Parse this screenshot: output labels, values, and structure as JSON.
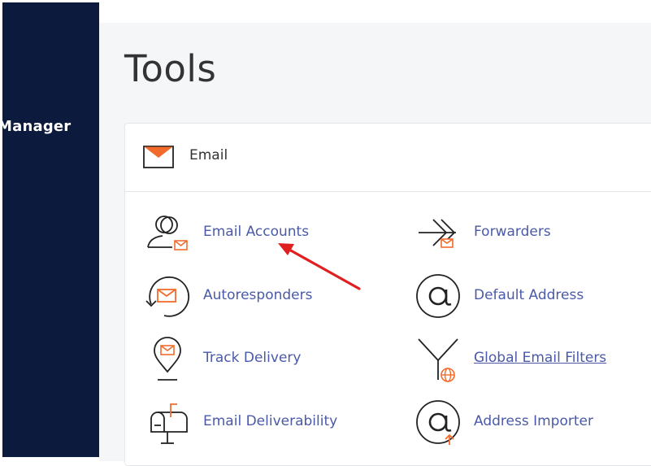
{
  "sidebar": {
    "label": "Manager"
  },
  "page": {
    "title": "Tools"
  },
  "panel": {
    "title": "Email",
    "tools": [
      {
        "label": "Email Accounts",
        "icon": "email-accounts-icon"
      },
      {
        "label": "Forwarders",
        "icon": "forwarders-icon"
      },
      {
        "label": "Autoresponders",
        "icon": "autoresponders-icon"
      },
      {
        "label": "Default Address",
        "icon": "default-address-icon"
      },
      {
        "label": "Track Delivery",
        "icon": "track-delivery-icon"
      },
      {
        "label": "Global Email Filters",
        "icon": "global-email-filters-icon"
      },
      {
        "label": "Email Deliverability",
        "icon": "email-deliverability-icon"
      },
      {
        "label": "Address Importer",
        "icon": "address-importer-icon"
      }
    ]
  },
  "colors": {
    "sidebar": "#0b1a3d",
    "accent": "#f26b2c",
    "link": "#4a5aa8",
    "annotation_arrow": "#e02020"
  }
}
